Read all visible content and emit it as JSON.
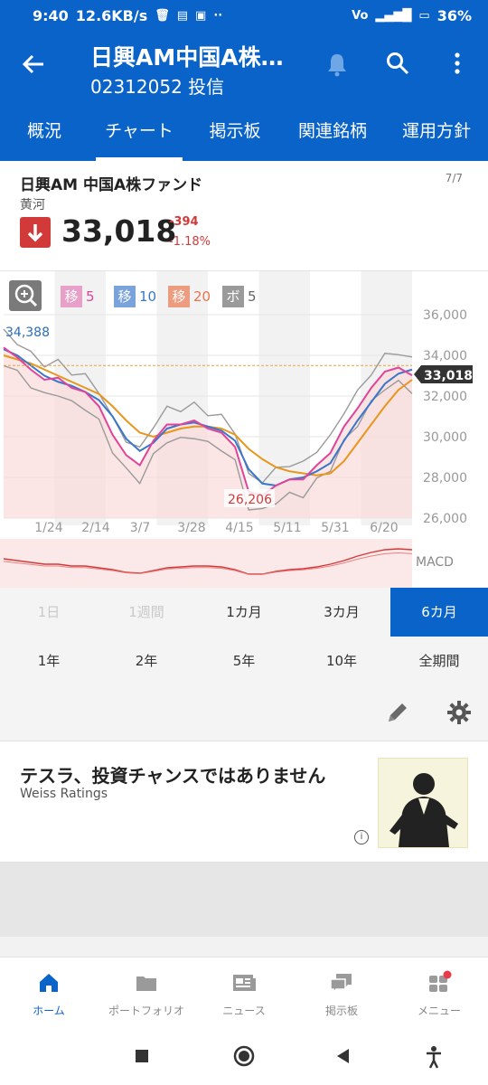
{
  "status": {
    "time": "9:40",
    "speed": "12.6KB/s",
    "battery": "36%"
  },
  "header": {
    "title": "日興AM中国A株…",
    "code": "02312052 投信"
  },
  "tabs": [
    "概況",
    "チャート",
    "掲示板",
    "関連銘柄",
    "運用方針"
  ],
  "fund": {
    "name": "日興AM 中国A株ファンド",
    "date": "7/7",
    "manager": "黄河",
    "price": "33,018",
    "change": "-394",
    "change_pct": "-1.18%"
  },
  "chart_data": {
    "type": "line",
    "legend": [
      {
        "label": "移",
        "period": "5",
        "color": "#e0449a"
      },
      {
        "label": "移",
        "period": "10",
        "color": "#3a76c9"
      },
      {
        "label": "移",
        "period": "20",
        "color": "#e8734c"
      },
      {
        "label": "ボ",
        "period": "5",
        "color": "#888888"
      }
    ],
    "ylim": [
      26000,
      36000
    ],
    "y_ticks": [
      "36,000",
      "34,000",
      "32,000",
      "30,000",
      "28,000",
      "26,000"
    ],
    "x_ticks": [
      "1/24",
      "2/14",
      "3/7",
      "3/28",
      "4/15",
      "5/11",
      "5/31",
      "6/20"
    ],
    "high_label": "34,388",
    "low_label": "26,206",
    "last_label": "33,018",
    "macd_label": "MACD",
    "series": [
      {
        "name": "移5",
        "values": [
          34388,
          33900,
          33300,
          32800,
          32900,
          32400,
          32200,
          31500,
          30100,
          29100,
          28600,
          29800,
          30600,
          30600,
          30800,
          30400,
          30200,
          29500,
          27300,
          27100,
          27600,
          27900,
          27900,
          28600,
          29200,
          30500,
          31400,
          32400,
          33200,
          33400,
          33018
        ]
      },
      {
        "name": "移10",
        "values": [
          34300,
          34000,
          33500,
          33000,
          32700,
          32500,
          32200,
          31800,
          31000,
          29900,
          29300,
          29700,
          30400,
          30600,
          30700,
          30500,
          30300,
          29800,
          28400,
          27700,
          27600,
          27900,
          28000,
          28300,
          28700,
          29800,
          30800,
          31700,
          32600,
          33100,
          33300
        ]
      },
      {
        "name": "移20",
        "values": [
          34000,
          33800,
          33600,
          33300,
          33000,
          32700,
          32400,
          32100,
          31500,
          30800,
          30200,
          30000,
          30200,
          30400,
          30500,
          30500,
          30400,
          30100,
          29400,
          28900,
          28500,
          28300,
          28200,
          28100,
          28200,
          28800,
          29700,
          30600,
          31500,
          32300,
          32800
        ]
      }
    ],
    "macd": [
      0.3,
      0.2,
      0.1,
      0.0,
      0.0,
      -0.1,
      -0.1,
      -0.2,
      -0.3,
      -0.45,
      -0.5,
      -0.35,
      -0.2,
      -0.15,
      -0.1,
      -0.1,
      -0.15,
      -0.3,
      -0.55,
      -0.55,
      -0.4,
      -0.3,
      -0.25,
      -0.15,
      0.0,
      0.2,
      0.45,
      0.65,
      0.8,
      0.85,
      0.8
    ]
  },
  "periods_row1": [
    "1日",
    "1週間",
    "1カ月",
    "3カ月",
    "6カ月"
  ],
  "periods_row2": [
    "1年",
    "2年",
    "5年",
    "10年",
    "全期間"
  ],
  "ad": {
    "title": "テスラ、投資チャンスではありません",
    "source": "Weiss Ratings"
  },
  "nav": [
    "ホーム",
    "ポートフォリオ",
    "ニュース",
    "掲示板",
    "メニュー"
  ],
  "colors": {
    "brand": "#0a63c9",
    "down": "#d23a3a"
  }
}
